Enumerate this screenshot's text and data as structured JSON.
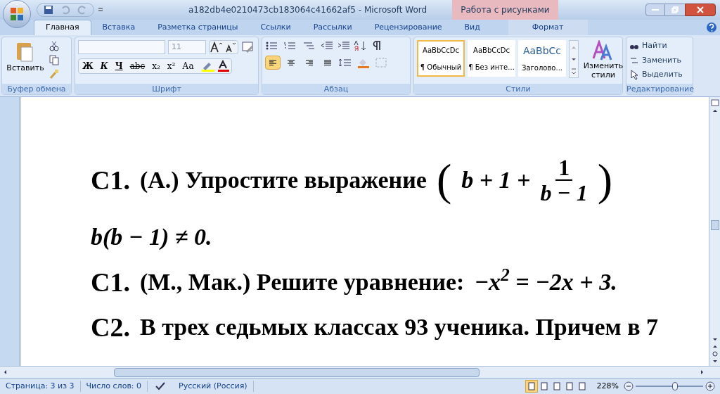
{
  "window": {
    "title": "a182db4e0210473cb183064c41662af5 - Microsoft Word",
    "context_group": "Работа с рисунками"
  },
  "tabs": [
    {
      "label": "Главная",
      "selected": true,
      "contextual": false
    },
    {
      "label": "Вставка",
      "selected": false,
      "contextual": false
    },
    {
      "label": "Разметка страницы",
      "selected": false,
      "contextual": false
    },
    {
      "label": "Ссылки",
      "selected": false,
      "contextual": false
    },
    {
      "label": "Рассылки",
      "selected": false,
      "contextual": false
    },
    {
      "label": "Рецензирование",
      "selected": false,
      "contextual": false
    },
    {
      "label": "Вид",
      "selected": false,
      "contextual": false
    },
    {
      "label": "Формат",
      "selected": false,
      "contextual": true
    }
  ],
  "clipboard": {
    "paste": "Вставить",
    "group": "Буфер обмена"
  },
  "font": {
    "size": "11",
    "format_buttons": [
      "Ж",
      "К",
      "Ч",
      "abc",
      "x₂",
      "x²",
      "Аа"
    ],
    "group": "Шрифт"
  },
  "paragraph": {
    "align": [
      {
        "kind": "left",
        "selected": true
      },
      {
        "kind": "center",
        "selected": false
      },
      {
        "kind": "right",
        "selected": false
      },
      {
        "kind": "justify",
        "selected": false
      }
    ],
    "group": "Абзац"
  },
  "styles": {
    "items": [
      {
        "preview": "AaBbCcDc",
        "name": "¶ Обычный",
        "selected": true,
        "kind": "normal"
      },
      {
        "preview": "AaBbCcDc",
        "name": "¶ Без инте...",
        "selected": false,
        "kind": "normal"
      },
      {
        "preview": "AaBbCc",
        "name": "Заголово...",
        "selected": false,
        "kind": "heading"
      }
    ],
    "change": "Изменить стили",
    "group": "Стили"
  },
  "editing": {
    "find": "Найти",
    "replace": "Заменить",
    "select": "Выделить",
    "group": "Редактирование"
  },
  "document": {
    "lines": [
      {
        "segments": [
          {
            "kind": "label",
            "text": "С1."
          },
          {
            "kind": "text",
            "text": "(А.) Упростите выражение"
          },
          {
            "kind": "paren",
            "text": "("
          },
          {
            "kind": "math",
            "text": "b + 1 +"
          },
          {
            "kind": "fraction",
            "num": "1",
            "den": "b − 1"
          },
          {
            "kind": "paren",
            "text": ")"
          }
        ]
      },
      {
        "segments": [
          {
            "kind": "math",
            "text": "b(b − 1) ≠ 0."
          }
        ]
      },
      {
        "segments": [
          {
            "kind": "label",
            "text": "С1."
          },
          {
            "kind": "text",
            "text": "(М., Мак.) Решите уравнение:"
          },
          {
            "kind": "math",
            "text": "−x$^{2}$ = −2x + 3."
          }
        ]
      },
      {
        "segments": [
          {
            "kind": "label",
            "text": "С2."
          },
          {
            "kind": "text",
            "text": "В трех седьмых классах 93 ученика. Причем в 7"
          }
        ]
      }
    ]
  },
  "status_bar": {
    "page": "Страница: 3 из 3",
    "words": "Число слов: 0",
    "language": "Русский (Россия)",
    "views": [
      {
        "selected": true
      },
      {
        "selected": false
      },
      {
        "selected": false
      },
      {
        "selected": false
      },
      {
        "selected": false
      }
    ],
    "zoom": "228%",
    "zoom_slider": {
      "level": 0.58
    }
  }
}
